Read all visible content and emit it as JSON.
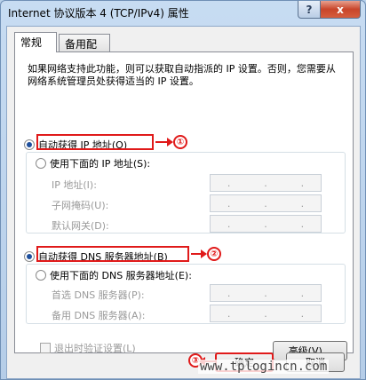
{
  "window": {
    "title": "Internet 协议版本 4 (TCP/IPv4) 属性",
    "help_glyph": "?",
    "close_glyph": "x"
  },
  "tabs": [
    {
      "label": "常规",
      "active": true
    },
    {
      "label": "备用配置",
      "active": false
    }
  ],
  "description": "如果网络支持此功能，则可以获取自动指派的 IP 设置。否则，您需要从网络系统管理员处获得适当的 IP 设置。",
  "ip_section": {
    "auto_label": "自动获得 IP 地址(O)",
    "auto_checked": true,
    "manual_label": "使用下面的 IP 地址(S):",
    "fields": [
      {
        "label": "IP 地址(I):"
      },
      {
        "label": "子网掩码(U):"
      },
      {
        "label": "默认网关(D):"
      }
    ]
  },
  "dns_section": {
    "auto_label": "自动获得 DNS 服务器地址(B)",
    "auto_checked": true,
    "manual_label": "使用下面的 DNS 服务器地址(E):",
    "fields": [
      {
        "label": "首选 DNS 服务器(P):"
      },
      {
        "label": "备用 DNS 服务器(A):"
      }
    ]
  },
  "validate_label": "退出时验证设置(L)",
  "advanced_label": "高级(V)...",
  "ok_label": "确定",
  "cancel_label": "取消",
  "annotations": [
    "①",
    "②",
    "③"
  ],
  "ip_dot": ".",
  "watermark": "www.tplogincn.com",
  "colors": {
    "annotation": "#e01a1a",
    "radio_dot": "#1e4f9c"
  }
}
